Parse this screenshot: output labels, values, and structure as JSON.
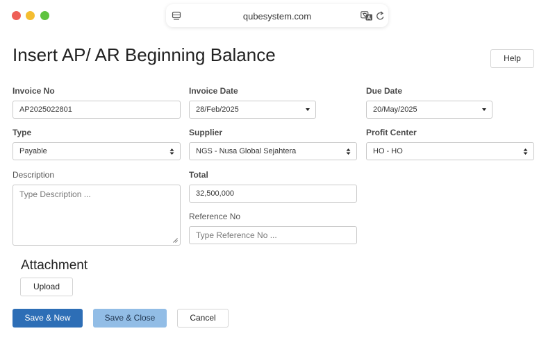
{
  "browser": {
    "url": "qubesystem.com"
  },
  "page": {
    "title": "Insert AP/ AR Beginning Balance",
    "help_label": "Help"
  },
  "form": {
    "invoice_no": {
      "label": "Invoice No",
      "value": "AP2025022801"
    },
    "invoice_date": {
      "label": "Invoice Date",
      "value": "28/Feb/2025"
    },
    "due_date": {
      "label": "Due Date",
      "value": "20/May/2025"
    },
    "type": {
      "label": "Type",
      "value": "Payable"
    },
    "supplier": {
      "label": "Supplier",
      "value": "NGS - Nusa Global Sejahtera"
    },
    "profit_center": {
      "label": "Profit Center",
      "value": "HO - HO"
    },
    "description": {
      "label": "Description",
      "placeholder": "Type Description ..."
    },
    "total": {
      "label": "Total",
      "value": "32,500,000"
    },
    "reference_no": {
      "label": "Reference No",
      "placeholder": "Type Reference No ..."
    }
  },
  "attachment": {
    "title": "Attachment",
    "upload_label": "Upload"
  },
  "actions": {
    "save_new": "Save & New",
    "save_close": "Save & Close",
    "cancel": "Cancel"
  },
  "colors": {
    "primary": "#2d6eb6",
    "primary_light": "#92bde6",
    "traffic_red": "#ee5f57",
    "traffic_yellow": "#f4bd30",
    "traffic_green": "#5fc340"
  }
}
